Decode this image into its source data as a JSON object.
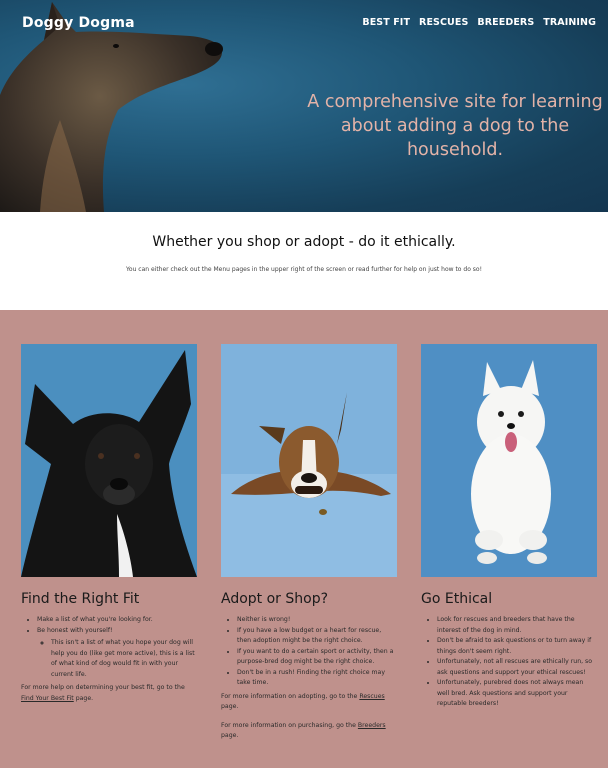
{
  "header": {
    "brand": "Doggy Dogma",
    "nav": [
      "BEST FIT",
      "RESCUES",
      "BREEDERS",
      "TRAINING"
    ],
    "tagline": "A comprehensive site for learning about adding a dog to the household."
  },
  "intro": {
    "heading": "Whether you shop or adopt - do it ethically.",
    "text": "You can either check out the Menu pages in the upper right of the screen or read further for help on just how to do so!"
  },
  "cards": [
    {
      "title": "Find the Right Fit",
      "bullets": [
        "Make a list of what you're looking for.",
        "Be honest with yourself!"
      ],
      "sub_bullets": [
        "This isn't a list of what you hope your dog will help you do (like get more active), this is a list of what kind of dog would fit in with your current life."
      ],
      "p1_before": "For more help on determining your best fit, go to the ",
      "p1_link": "Find Your Best Fit",
      "p1_after": " page."
    },
    {
      "title": "Adopt or Shop?",
      "bullets": [
        "Neither is wrong!",
        "If you have a low budget or a heart for rescue, then adoption might be the right choice.",
        "If you want to do a certain sport or activity, then a purpose-bred dog might be the right choice.",
        "Don't be in a rush! Finding the right choice may take time."
      ],
      "p1_before": "For more information on adopting, go to the ",
      "p1_link": "Rescues",
      "p1_after": " page.",
      "p2_before": "For more information on purchasing, go the ",
      "p2_link": "Breeders",
      "p2_after": " page."
    },
    {
      "title": "Go Ethical",
      "bullets": [
        "Look for rescues and breeders that have the interest of the dog in mind.",
        "Don't be afraid to ask questions or to turn away if things don't seem right.",
        "Unfortunately, not all rescues are ethically run, so ask questions and support your ethical rescues!",
        "Unfortunately, purebred does not always mean well bred. Ask questions and support your reputable breeders!"
      ]
    }
  ]
}
